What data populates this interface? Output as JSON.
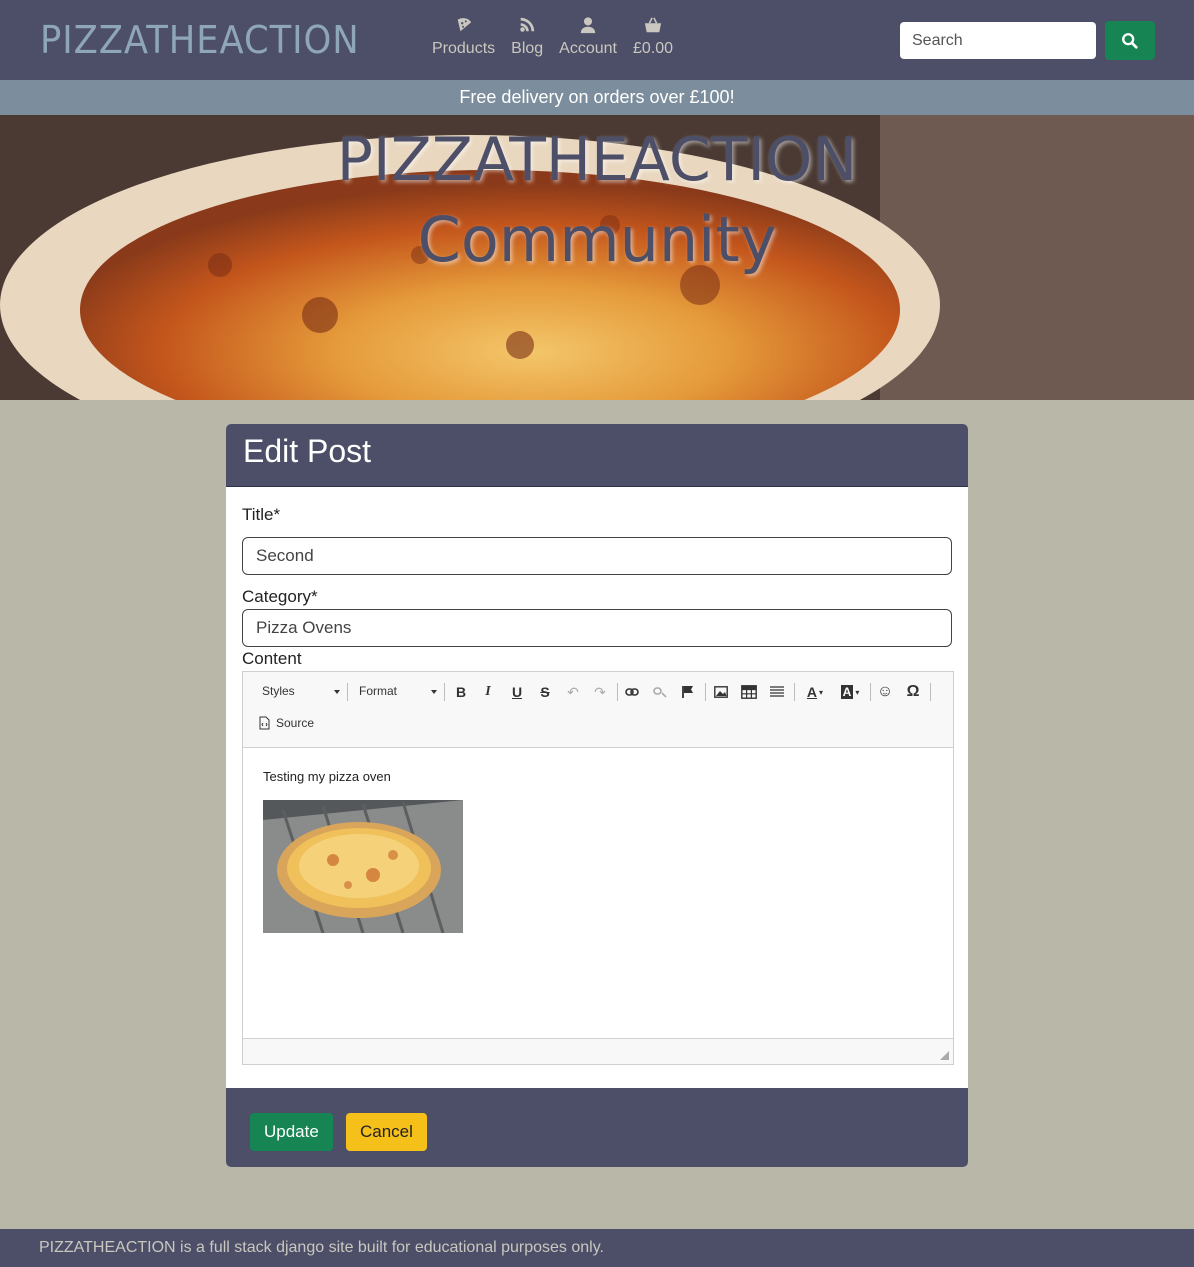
{
  "nav": {
    "brand": "PIZZATHEACTION",
    "links": [
      {
        "label": "Products",
        "icon": "pizza-icon"
      },
      {
        "label": "Blog",
        "icon": "rss-icon"
      },
      {
        "label": "Account",
        "icon": "user-icon"
      },
      {
        "label": "£0.00",
        "icon": "basket-icon"
      }
    ],
    "search_placeholder": "Search"
  },
  "banner": "Free delivery on orders over £100!",
  "hero": {
    "line1": "PIZZATHEACTION",
    "line2": "Community"
  },
  "form": {
    "header": "Edit Post",
    "title_label": "Title*",
    "title_value": "Second",
    "category_label": "Category*",
    "category_value": "Pizza Ovens",
    "content_label": "Content",
    "editor": {
      "styles_label": "Styles",
      "format_label": "Format",
      "source_label": "Source",
      "body_text": "Testing my pizza oven"
    },
    "update_label": "Update",
    "cancel_label": "Cancel"
  },
  "footer": "PIZZATHEACTION is a full stack django site built for educational purposes only.",
  "colors": {
    "navy": "#4c4f67",
    "green": "#168553",
    "yellow": "#f6c01a",
    "page_bg": "#b8b7a8",
    "banner": "#7c8e9d"
  }
}
